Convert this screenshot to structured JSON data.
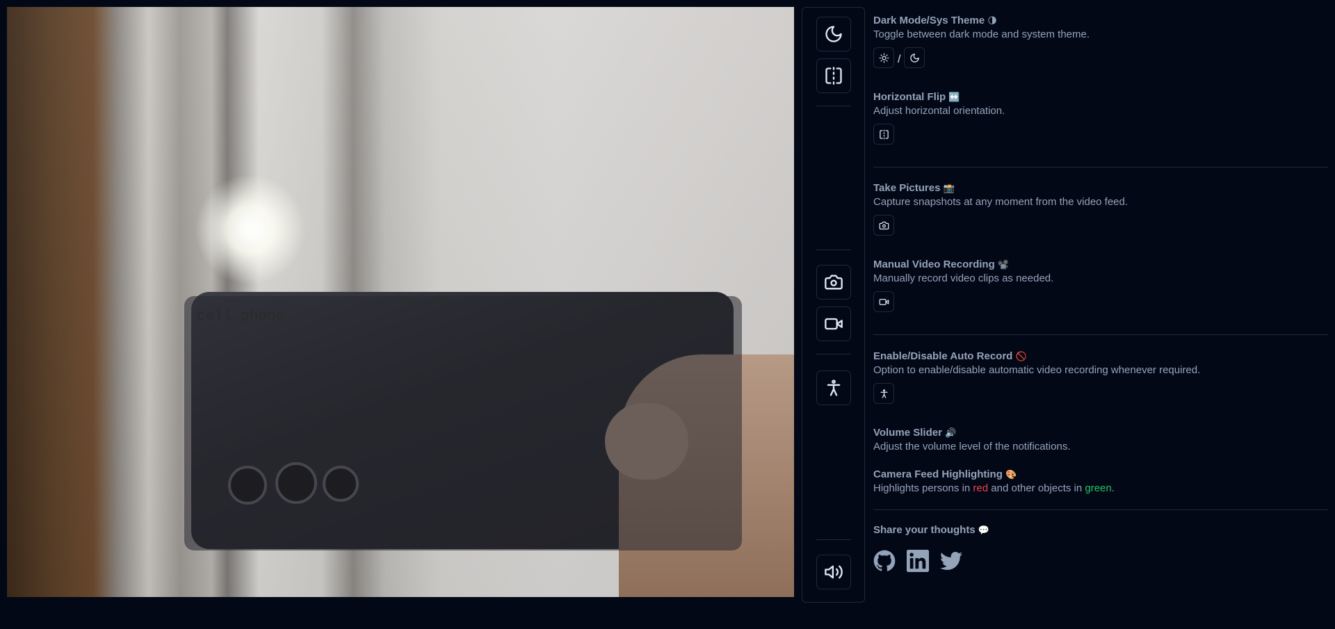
{
  "video": {
    "detection_label": "cell phone"
  },
  "sections": {
    "theme": {
      "title": "Dark Mode/Sys Theme",
      "emoji": "🌗",
      "description": "Toggle between dark mode and system theme.",
      "separator": "/"
    },
    "flip": {
      "title": "Horizontal Flip",
      "emoji": "↔️",
      "description": "Adjust horizontal orientation."
    },
    "pictures": {
      "title": "Take Pictures",
      "emoji": "📸",
      "description": "Capture snapshots at any moment from the video feed."
    },
    "recording": {
      "title": "Manual Video Recording",
      "emoji": "📽️",
      "description": "Manually record video clips as needed."
    },
    "auto_record": {
      "title": "Enable/Disable Auto Record",
      "emoji": "🚫",
      "description": "Option to enable/disable automatic video recording whenever required."
    },
    "volume": {
      "title": "Volume Slider",
      "emoji": "🔊",
      "description": "Adjust the volume level of the notifications."
    },
    "highlighting": {
      "title": "Camera Feed Highlighting",
      "emoji": "🎨",
      "desc_prefix": "Highlights persons in ",
      "desc_red": "red",
      "desc_middle": " and other objects in ",
      "desc_green": "green",
      "desc_suffix": "."
    },
    "share": {
      "title": "Share your thoughts",
      "emoji": "💬"
    }
  },
  "icons": {
    "toolbar": [
      "moon-icon",
      "flip-horizontal-icon",
      "camera-icon",
      "video-icon",
      "accessibility-icon",
      "volume-icon"
    ],
    "socials": [
      "github-icon",
      "linkedin-icon",
      "twitter-icon"
    ]
  },
  "colors": {
    "background": "#030817",
    "border": "#1e293b",
    "text": "#94a3b8",
    "icon": "#e2e8f0",
    "red": "#ef4444",
    "green": "#22c55e"
  }
}
